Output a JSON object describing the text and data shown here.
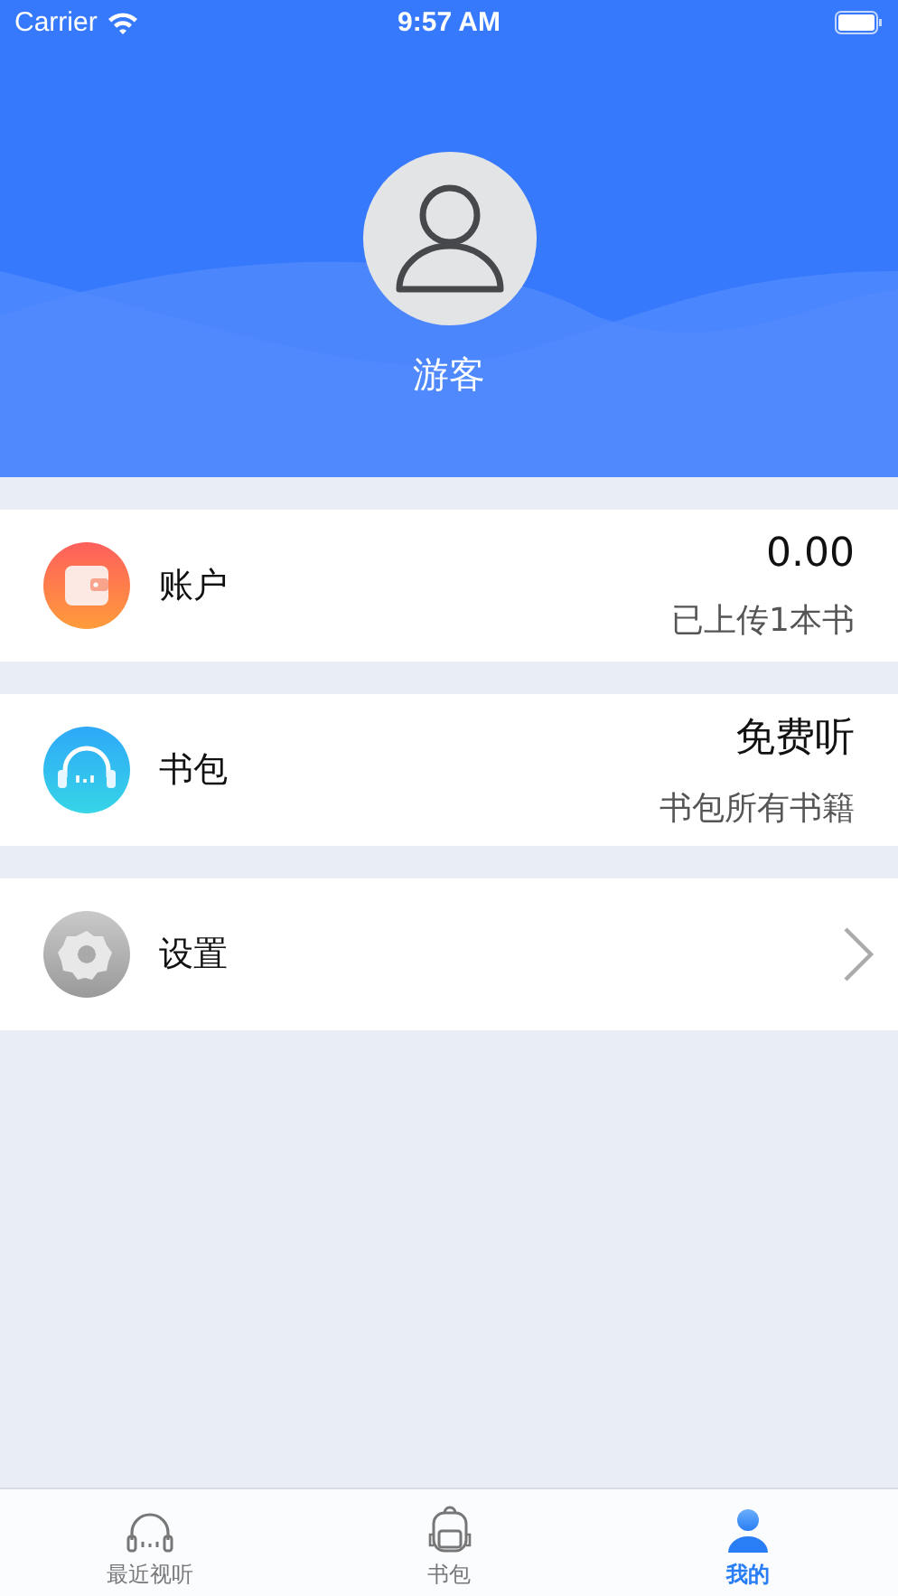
{
  "status_bar": {
    "carrier": "Carrier",
    "time": "9:57 AM"
  },
  "profile": {
    "name": "游客"
  },
  "menu": [
    {
      "kind": "value",
      "label": "账户",
      "value": "0.00",
      "note": "已上传1本书"
    },
    {
      "kind": "value",
      "label": "书包",
      "value": "免费听",
      "note": "书包所有书籍"
    },
    {
      "kind": "link",
      "label": "设置"
    }
  ],
  "tabs": [
    {
      "label": "最近视听",
      "selected": false
    },
    {
      "label": "书包",
      "selected": false
    },
    {
      "label": "我的",
      "selected": true
    }
  ]
}
